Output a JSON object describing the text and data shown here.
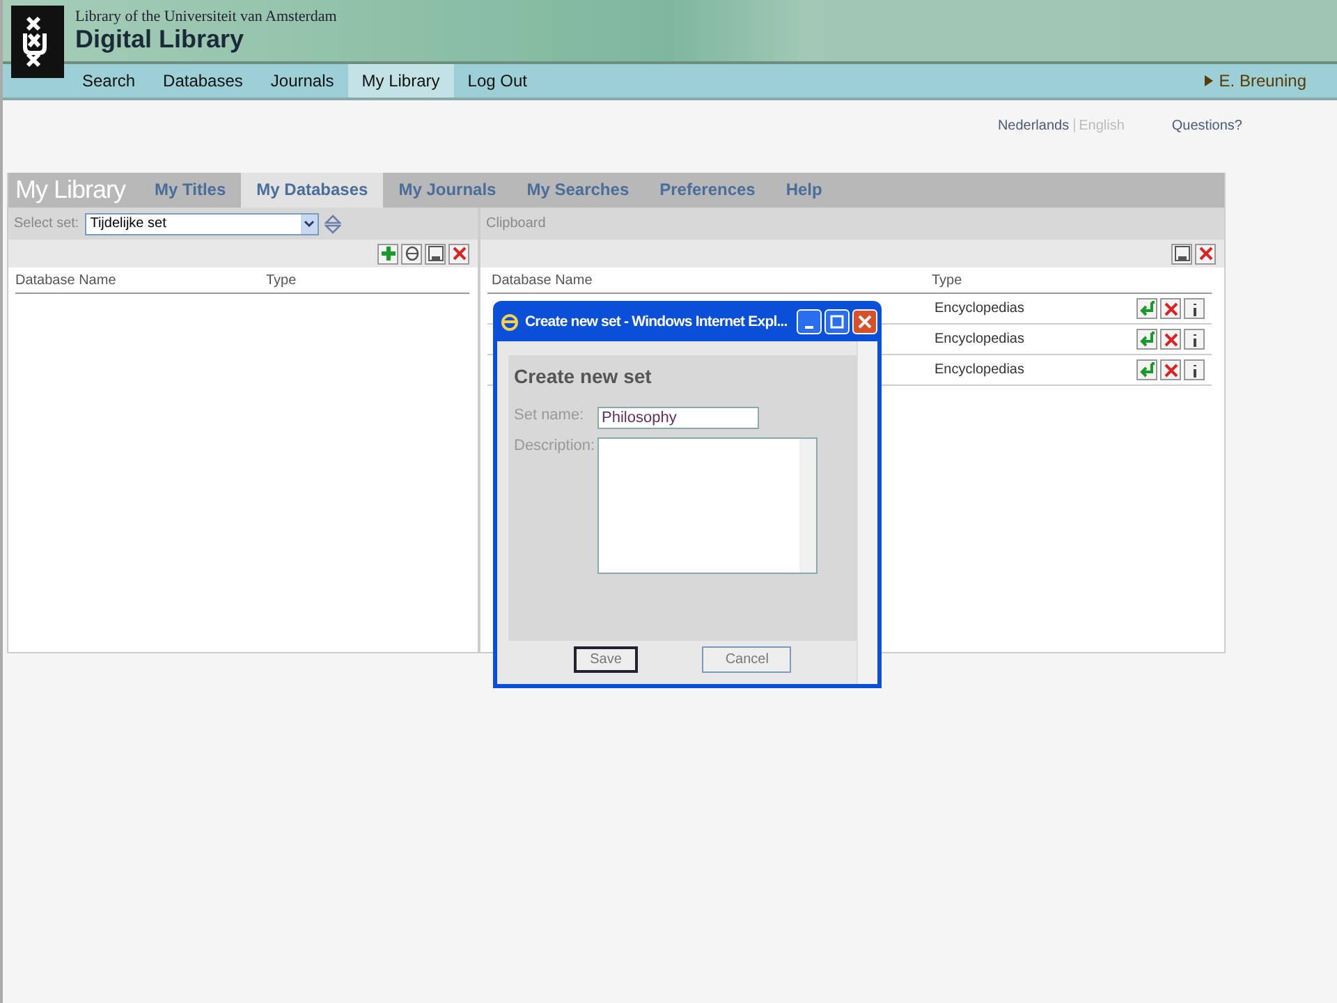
{
  "header": {
    "subtitle": "Library of the Universiteit van Amsterdam",
    "title": "Digital Library"
  },
  "nav": [
    {
      "label": "Search",
      "selected": false
    },
    {
      "label": "Databases",
      "selected": false
    },
    {
      "label": "Journals",
      "selected": false
    },
    {
      "label": "My Library",
      "selected": true
    },
    {
      "label": "Log Out",
      "selected": false
    }
  ],
  "user": "E. Breuning",
  "languages": [
    {
      "label": "Nederlands",
      "selected": false
    },
    {
      "label": "English",
      "selected": true
    }
  ],
  "questions": "Questions?",
  "section_title": "My Library",
  "tabs": [
    {
      "label": "My Titles",
      "selected": false
    },
    {
      "label": "My Databases",
      "selected": true
    },
    {
      "label": "My Journals",
      "selected": false
    },
    {
      "label": "My Searches",
      "selected": false
    },
    {
      "label": "Preferences",
      "selected": false
    },
    {
      "label": "Help",
      "selected": false
    }
  ],
  "select_set": {
    "label": "Select set:",
    "value": "Tijdelijke set"
  },
  "clipboard": "Clipboard",
  "left_table": {
    "columns": [
      "Database Name",
      "Type"
    ]
  },
  "right_table": {
    "columns": [
      "Database Name",
      "Type"
    ],
    "rows": [
      {
        "type": "Encyclopedias"
      },
      {
        "type": "Encyclopedias"
      },
      {
        "type": "Encyclopedias"
      }
    ]
  },
  "dialog": {
    "title": "Create new set - Windows Internet Expl...",
    "heading": "Create new set",
    "set_name_label": "Set name:",
    "set_name": "Philosophy",
    "description_label": "Description:",
    "buttons": [
      "Save",
      "Cancel"
    ]
  }
}
